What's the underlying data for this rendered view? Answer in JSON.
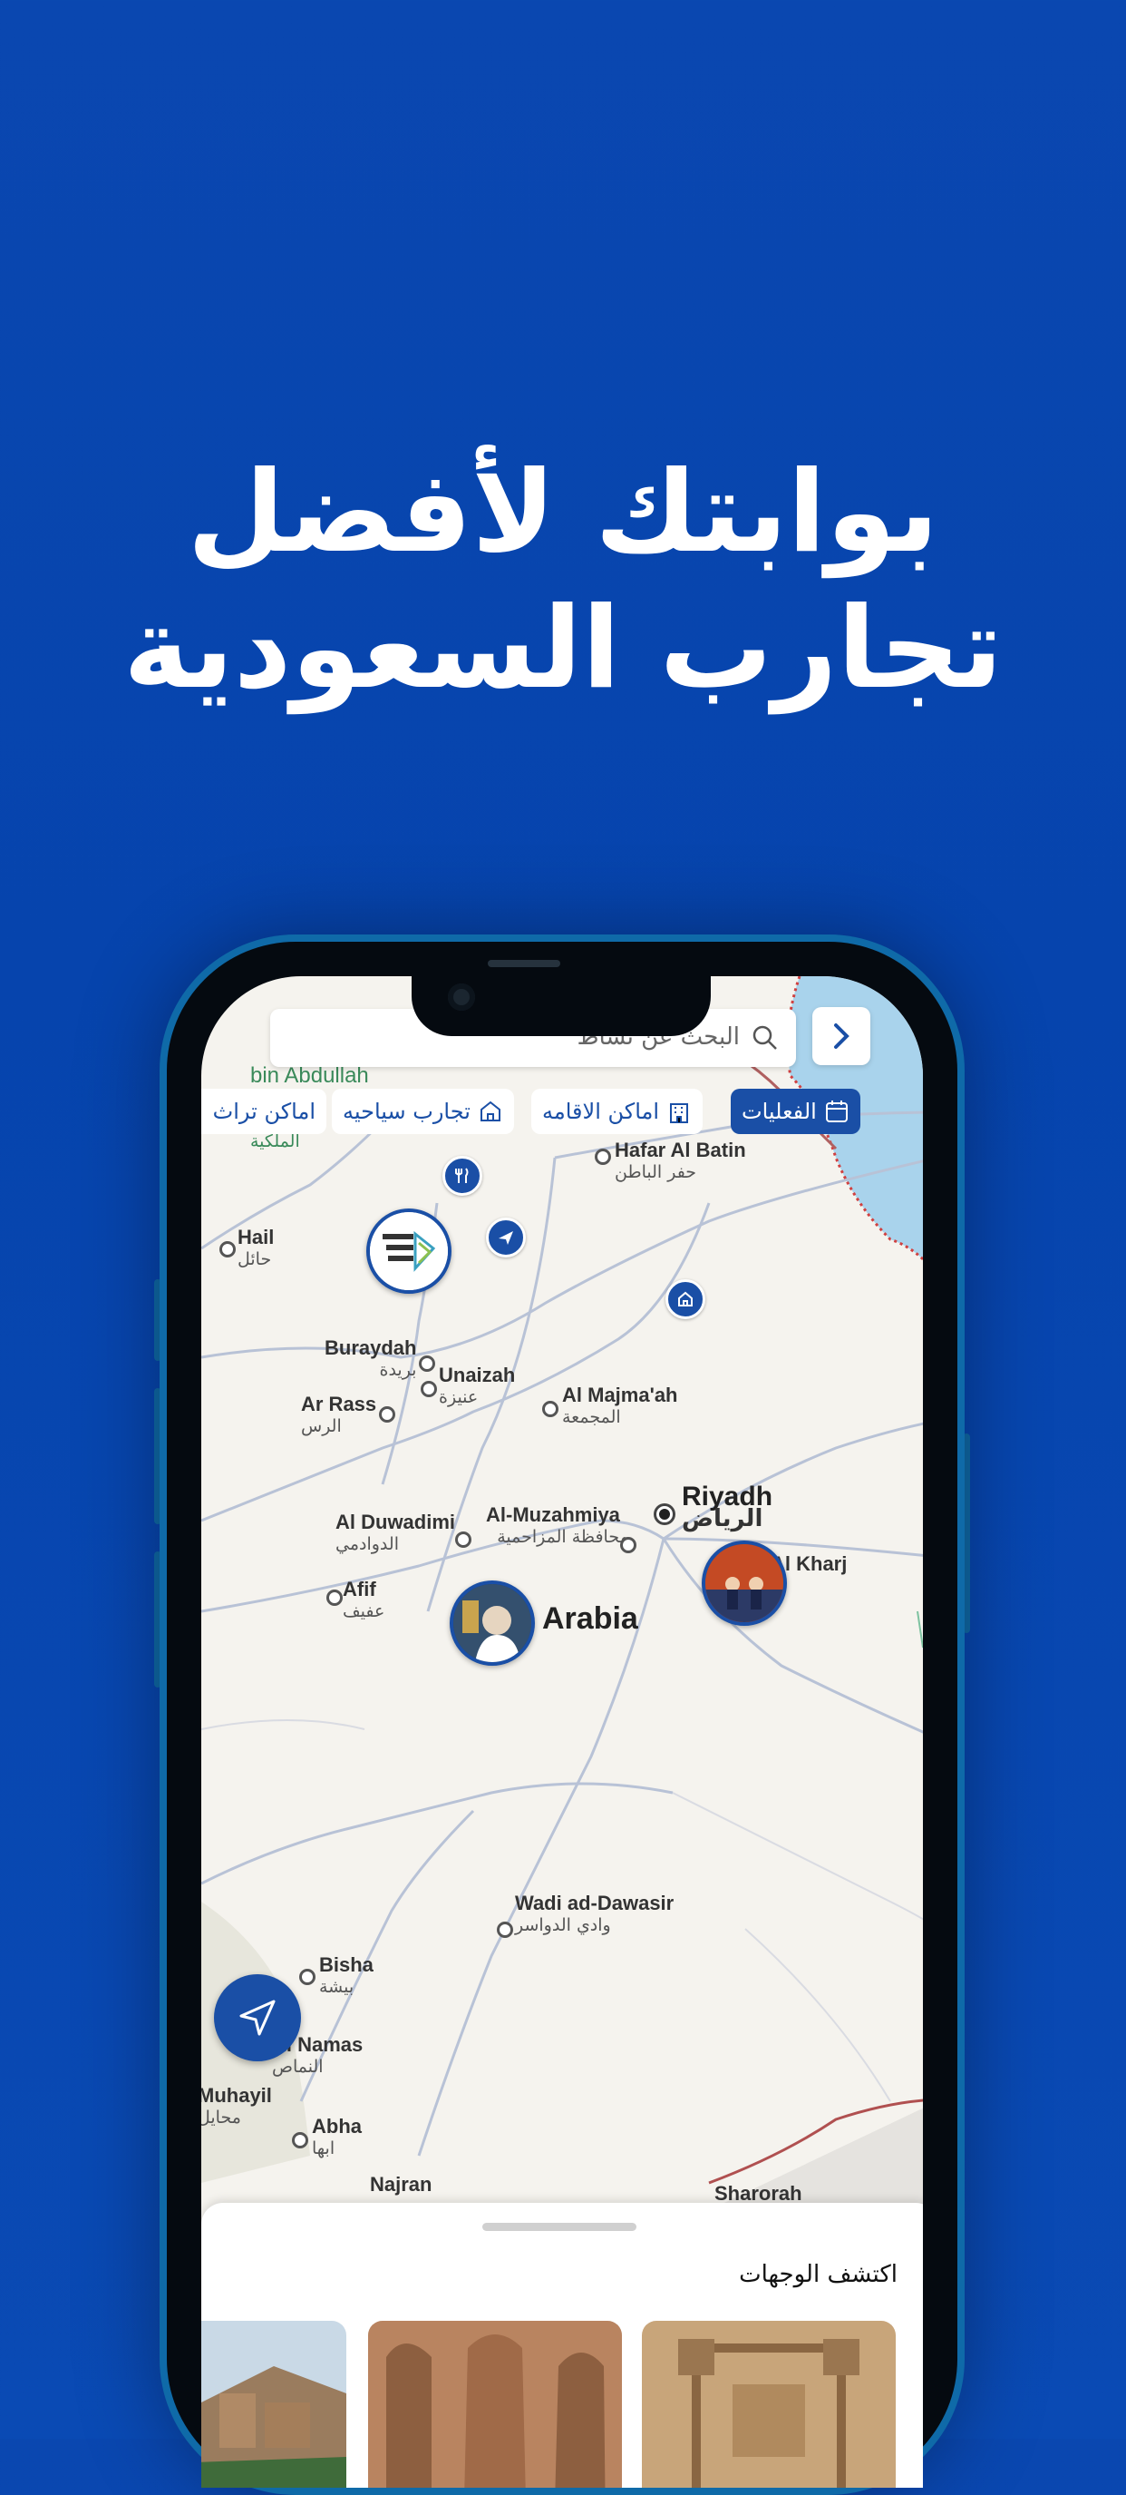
{
  "headline": {
    "line1": "بوابتك لأفضل",
    "line2": "تجارب السعودية"
  },
  "search": {
    "placeholder": "البحث عن نشاط"
  },
  "chips": [
    {
      "label": "الفعليات",
      "icon": "calendar-icon",
      "active": true
    },
    {
      "label": "اماكن الاقامه",
      "icon": "hotel-icon",
      "active": false
    },
    {
      "label": "تجارب سياحيه",
      "icon": "tour-icon",
      "active": false
    },
    {
      "label": "اماكن تراث",
      "icon": "heritage-icon",
      "active": false
    }
  ],
  "map": {
    "places": [
      {
        "en": "Hafar Al Batin",
        "ar": "حفر الباطن"
      },
      {
        "en": "Hail",
        "ar": "حائل"
      },
      {
        "en": "Buraydah",
        "ar": "بريدة"
      },
      {
        "en": "Unaizah",
        "ar": "عنيزة"
      },
      {
        "en": "Ar Rass",
        "ar": "الرس"
      },
      {
        "en": "Al Majma'ah",
        "ar": "المجمعة"
      },
      {
        "en": "Riyadh",
        "ar": "الرياض"
      },
      {
        "en": "Al Duwadimi",
        "ar": "الدوادمي"
      },
      {
        "en": "Al-Muzahmiya",
        "ar": "محافظة المزاحمية"
      },
      {
        "en": "Afif",
        "ar": "عفيف"
      },
      {
        "en": "Arabia",
        "ar": ""
      },
      {
        "en": "Wadi ad-Dawasir",
        "ar": "وادي الدواسر"
      },
      {
        "en": "Bisha",
        "ar": "بيشة"
      },
      {
        "en": "Al Namas",
        "ar": "النماص"
      },
      {
        "en": "Muhayil",
        "ar": "محايل"
      },
      {
        "en": "Abha",
        "ar": "ابها"
      },
      {
        "en": "Najran",
        "ar": ""
      },
      {
        "en": "Sharorah",
        "ar": ""
      },
      {
        "en": "Al Kharj",
        "ar": ""
      },
      {
        "en": "bin Abdullah",
        "ar": "تركي بن عبدالله الملكية"
      }
    ]
  },
  "sheet": {
    "title": "اكتشف الوجهات"
  },
  "colors": {
    "background": "#0644ad",
    "accent": "#1a4fa6",
    "phone_frame": "#0f6aa8"
  }
}
